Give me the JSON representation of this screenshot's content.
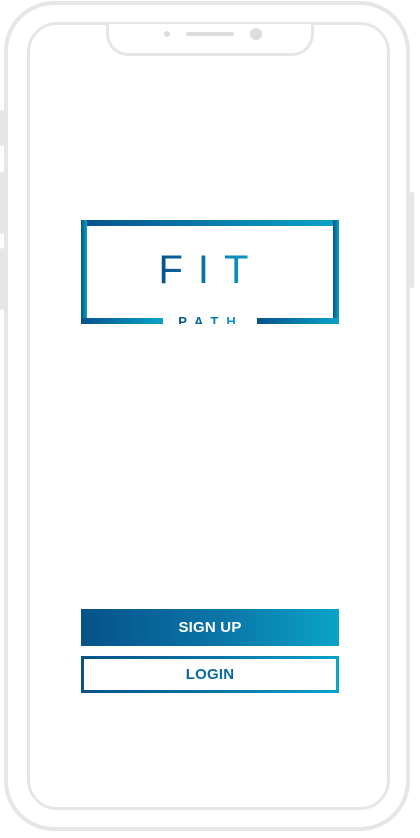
{
  "logo": {
    "title": "FIT",
    "subtitle": "PATH",
    "gradient_start": "#06528a",
    "gradient_end": "#0aa3c8"
  },
  "actions": {
    "signup_label": "SIGN UP",
    "login_label": "LOGIN"
  },
  "colors": {
    "accent_dark": "#06528a",
    "accent_light": "#0aa3c8",
    "device_frame": "#e6e6e6"
  }
}
